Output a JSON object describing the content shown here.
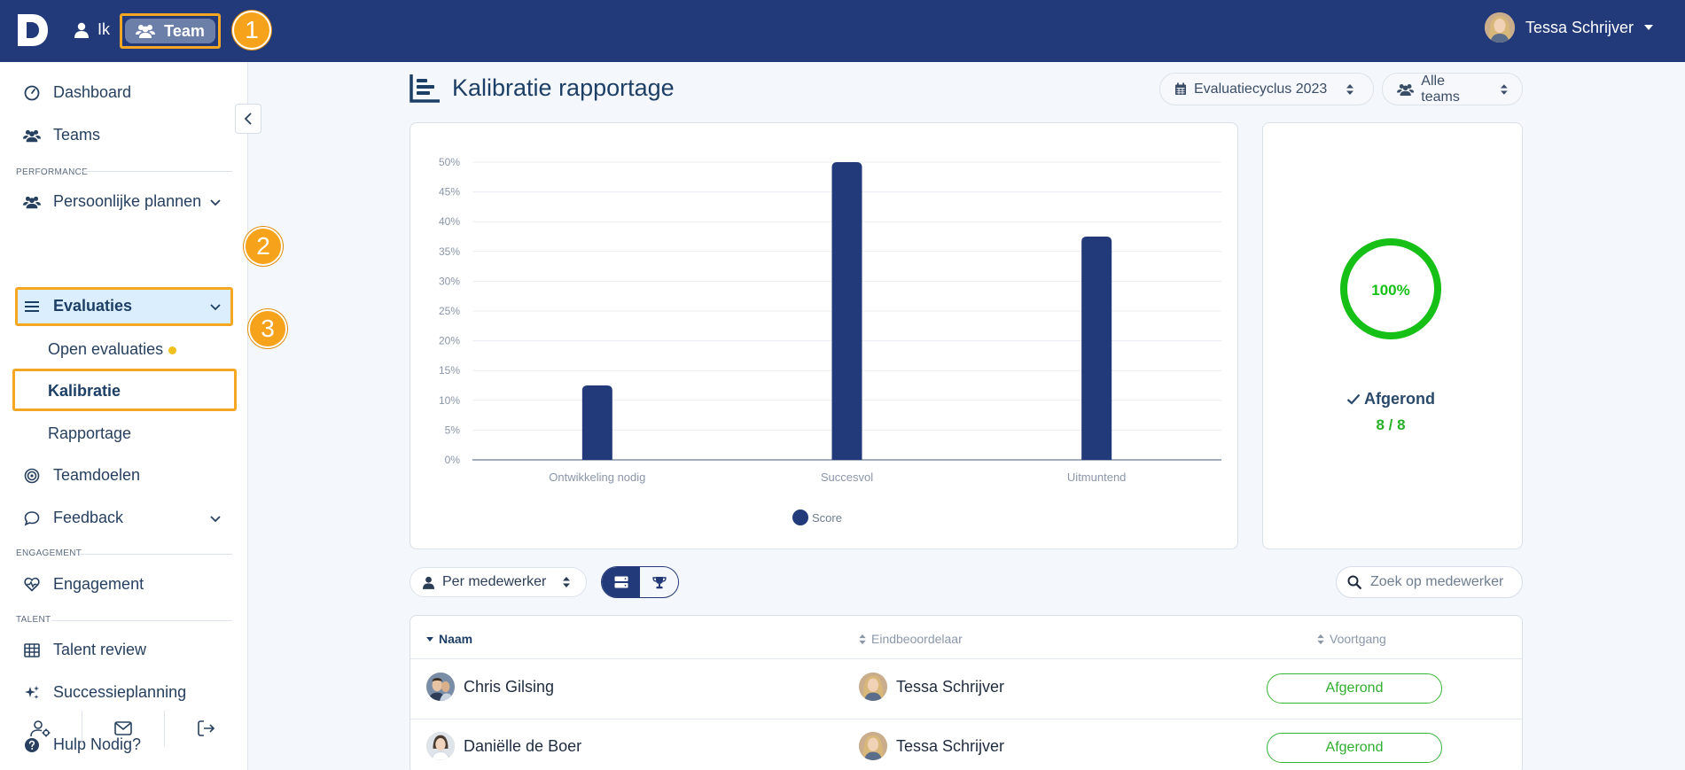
{
  "topbar": {
    "logo": "D",
    "nav_ik": "Ik",
    "nav_team": "Team",
    "user_name": "Tessa Schrijver"
  },
  "badges": [
    "1",
    "2",
    "3"
  ],
  "sidebar": {
    "dashboard": "Dashboard",
    "teams": "Teams",
    "section_performance": "PERFORMANCE",
    "persoonlijke_plannen": "Persoonlijke plannen",
    "evaluaties": "Evaluaties",
    "open_evaluaties": "Open evaluaties",
    "kalibratie": "Kalibratie",
    "rapportage": "Rapportage",
    "teamdoelen": "Teamdoelen",
    "feedback": "Feedback",
    "section_engagement": "ENGAGEMENT",
    "engagement": "Engagement",
    "section_talent": "TALENT",
    "talent_review": "Talent review",
    "successieplanning": "Successieplanning",
    "hulp": "Hulp Nodig?"
  },
  "header": {
    "title": "Kalibratie rapportage",
    "cycle_select": "Evaluatiecyclus 2023",
    "team_select": "Alle teams"
  },
  "chart_data": {
    "type": "bar",
    "categories": [
      "Ontwikkeling nodig",
      "Succesvol",
      "Uitmuntend"
    ],
    "series": [
      {
        "name": "Score",
        "values": [
          12.5,
          50,
          37.5
        ]
      }
    ],
    "ylim": [
      0,
      50
    ],
    "yticks": [
      "0%",
      "5%",
      "10%",
      "15%",
      "20%",
      "25%",
      "30%",
      "35%",
      "40%",
      "45%",
      "50%"
    ],
    "grid": true,
    "legend": "bottom",
    "color": "#233a7a"
  },
  "progress": {
    "percent_label": "100%",
    "percent": 100,
    "status_label": "Afgerond",
    "count": "8 / 8",
    "color": "#16c016"
  },
  "toolbar": {
    "group_select": "Per medewerker",
    "search_placeholder": "Zoek op medewerker"
  },
  "table": {
    "headers": [
      "Naam",
      "Eindbeoordelaar",
      "Voortgang"
    ],
    "rows": [
      {
        "naam": "Chris Gilsing",
        "eindbeoordelaar": "Tessa Schrijver",
        "voortgang": "Afgerond"
      },
      {
        "naam": "Daniëlle de Boer",
        "eindbeoordelaar": "Tessa Schrijver",
        "voortgang": "Afgerond"
      }
    ]
  }
}
